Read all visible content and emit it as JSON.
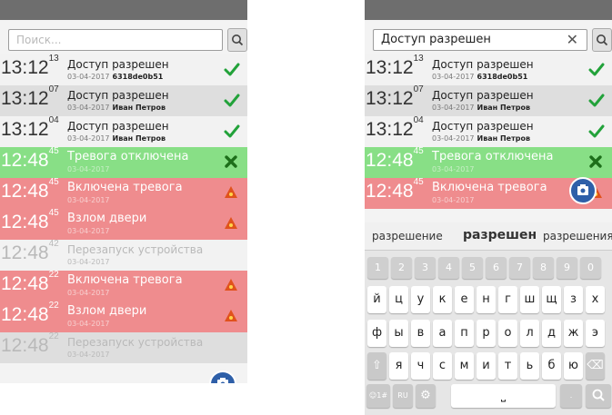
{
  "search_placeholder": "Поиск...",
  "search_query": "Доступ разрешен",
  "events_left": [
    {
      "time": "13:12",
      "sec": "13",
      "title": "Доступ разрешен",
      "date": "03-04-2017",
      "who": "6318de0b51",
      "cls": "r-light",
      "mark": "check"
    },
    {
      "time": "13:12",
      "sec": "07",
      "title": "Доступ разрешен",
      "date": "03-04-2017",
      "who": "Иван Петров",
      "cls": "r-grey",
      "mark": "check"
    },
    {
      "time": "13:12",
      "sec": "04",
      "title": "Доступ разрешен",
      "date": "03-04-2017",
      "who": "Иван Петров",
      "cls": "r-light",
      "mark": "check"
    },
    {
      "time": "12:48",
      "sec": "45",
      "title": "Тревога отключена",
      "date": "03-04-2017",
      "who": "",
      "cls": "r-green tw",
      "mark": "cross"
    },
    {
      "time": "12:48",
      "sec": "45",
      "title": "Включена тревога",
      "date": "03-04-2017",
      "who": "",
      "cls": "r-red tw",
      "mark": "warn"
    },
    {
      "time": "12:48",
      "sec": "45",
      "title": "Взлом двери",
      "date": "03-04-2017",
      "who": "",
      "cls": "r-red tw",
      "mark": "warn"
    },
    {
      "time": "12:48",
      "sec": "42",
      "title": "Перезапуск устройства",
      "date": "03-04-2017",
      "who": "",
      "cls": "r-light tg",
      "mark": ""
    },
    {
      "time": "12:48",
      "sec": "22",
      "title": "Включена тревога",
      "date": "03-04-2017",
      "who": "",
      "cls": "r-red tw",
      "mark": "warn"
    },
    {
      "time": "12:48",
      "sec": "22",
      "title": "Взлом двери",
      "date": "03-04-2017",
      "who": "",
      "cls": "r-red tw",
      "mark": "warn"
    },
    {
      "time": "12:48",
      "sec": "22",
      "title": "Перезапуск устройства",
      "date": "03-04-2017",
      "who": "",
      "cls": "r-grey tg",
      "mark": ""
    }
  ],
  "events_right": [
    {
      "time": "13:12",
      "sec": "13",
      "title": "Доступ разрешен",
      "date": "03-04-2017",
      "who": "6318de0b51",
      "cls": "r-light",
      "mark": "check"
    },
    {
      "time": "13:12",
      "sec": "07",
      "title": "Доступ разрешен",
      "date": "03-04-2017",
      "who": "Иван Петров",
      "cls": "r-grey",
      "mark": "check"
    },
    {
      "time": "13:12",
      "sec": "04",
      "title": "Доступ разрешен",
      "date": "03-04-2017",
      "who": "Иван Петров",
      "cls": "r-light",
      "mark": "check"
    },
    {
      "time": "12:48",
      "sec": "45",
      "title": "Тревога отключена",
      "date": "03-04-2017",
      "who": "",
      "cls": "r-green tw",
      "mark": "cross"
    },
    {
      "time": "12:48",
      "sec": "45",
      "title": "Включена тревога",
      "date": "03-04-2017",
      "who": "",
      "cls": "r-red tw",
      "mark": "warn"
    }
  ],
  "suggestions": [
    "разрешение",
    "разрешен",
    "разрешения"
  ],
  "key_rows": [
    [
      "1",
      "2",
      "3",
      "4",
      "5",
      "6",
      "7",
      "8",
      "9",
      "0"
    ],
    [
      "й",
      "ц",
      "у",
      "к",
      "е",
      "н",
      "г",
      "ш",
      "щ",
      "з",
      "х"
    ],
    [
      "ф",
      "ы",
      "в",
      "а",
      "п",
      "р",
      "о",
      "л",
      "д",
      "ж",
      "э"
    ],
    [
      "⇧",
      "я",
      "ч",
      "с",
      "м",
      "и",
      "т",
      "ь",
      "б",
      "ю",
      "⌫"
    ]
  ],
  "bottom_keys": {
    "sym": "☺1#",
    "lang": "RU",
    "settings": "⚙",
    "space": "⎵",
    "period": ".",
    "search": "🔍"
  },
  "icons": {
    "search": "search-icon",
    "clear": "close-icon",
    "check": "check-icon",
    "cross": "cross-icon",
    "warn": "alarm-warning-icon",
    "fab": "camera-folder-icon",
    "shift": "shift-icon",
    "backspace": "backspace-icon"
  },
  "colors": {
    "check": "#22a23a",
    "cross": "#1d6e1a",
    "warn": "#e0521c",
    "fab": "#2e5fa8",
    "status": "#6e6e6e"
  }
}
